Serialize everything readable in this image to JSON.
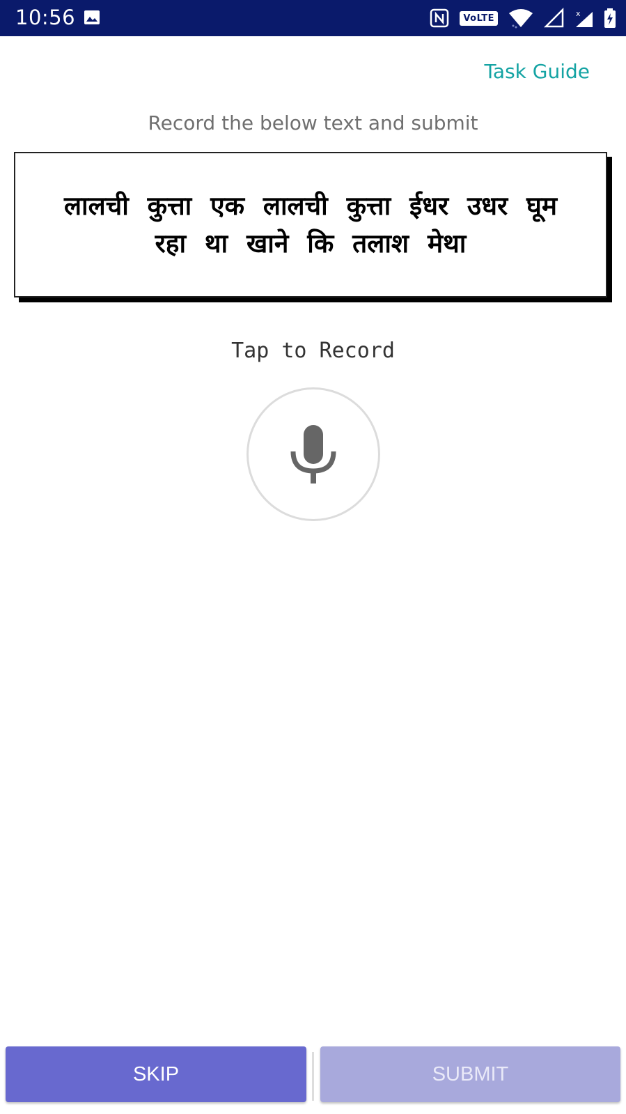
{
  "status_bar": {
    "time": "10:56",
    "volte": "VoLTE",
    "icons": [
      "gallery-icon",
      "nfc-icon",
      "volte-icon",
      "wifi-icon",
      "signal-icon",
      "signal-x-icon",
      "battery-charging-icon"
    ]
  },
  "header": {
    "task_guide": "Task Guide"
  },
  "instruction": "Record the below text and submit",
  "passage": "लालची कुत्ता एक लालची कुत्ता ईधर उधर घूम रहा था खाने कि तलाश मेथा",
  "record": {
    "label": "Tap to Record",
    "icon": "microphone-icon"
  },
  "actions": {
    "skip": "SKIP",
    "submit": "SUBMIT"
  },
  "colors": {
    "status_bar": "#0a1a6b",
    "accent": "#14a3a3",
    "skip": "#6869cf",
    "submit_disabled": "#a8a9dc"
  }
}
